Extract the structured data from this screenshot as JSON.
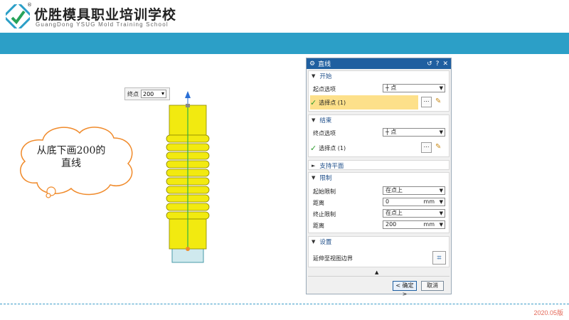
{
  "header": {
    "school_name": "优胜模具职业培训学校",
    "school_name_en": "GuangDong YSUG Mold Training School",
    "reg_mark": "®"
  },
  "footer": {
    "version": "2020.05版"
  },
  "callout": {
    "line1": "从底下画200的",
    "line2": "直线"
  },
  "viewport": {
    "endpoint_label": "终点",
    "endpoint_value": "200"
  },
  "colors": {
    "band": "#2c9fc7",
    "part": "#f2ea10",
    "dialog_title": "#1f5fa0",
    "highlight": "#fde08a"
  },
  "dialog": {
    "title": "直线",
    "controls": [
      "↺",
      "?",
      "✕"
    ],
    "start": {
      "header": "开始",
      "option_label": "起点选项",
      "option_value": "点",
      "select_label": "选择点 (1)"
    },
    "end": {
      "header": "结束",
      "option_label": "终点选项",
      "option_value": "点",
      "select_label": "选择点 (1)"
    },
    "support_plane": {
      "header": "支持平面"
    },
    "limits": {
      "header": "限制",
      "start_limit_label": "起始限制",
      "start_limit_value": "在点上",
      "distance1_label": "距离",
      "distance1_value": "0",
      "distance1_unit": "mm",
      "end_limit_label": "终止限制",
      "end_limit_value": "在点上",
      "distance2_label": "距离",
      "distance2_value": "200",
      "distance2_unit": "mm"
    },
    "settings": {
      "header": "设置",
      "extend_label": "延伸至视图边界"
    },
    "ok_label": "< 确定 >",
    "cancel_label": "取消"
  }
}
